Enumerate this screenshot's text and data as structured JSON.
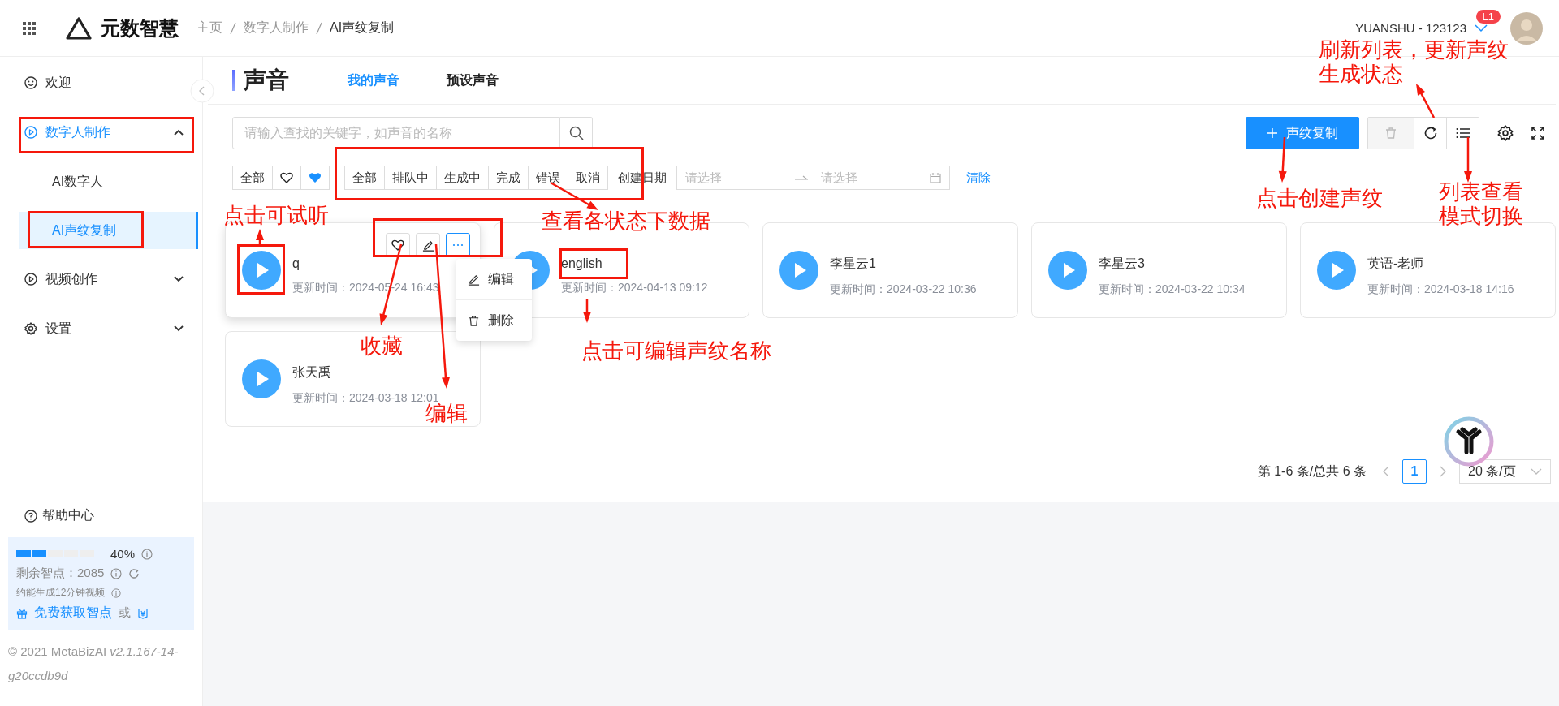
{
  "header": {
    "app_name": "元数智慧",
    "breadcrumbs": [
      "主页",
      "数字人制作",
      "AI声纹复制"
    ],
    "user": "YUANSHU - 123123",
    "level_badge": "L1"
  },
  "sidebar": {
    "items": [
      {
        "label": "欢迎"
      },
      {
        "label": "数字人制作",
        "expanded": true,
        "children": [
          {
            "label": "AI数字人",
            "selected": false
          },
          {
            "label": "AI声纹复制",
            "selected": true
          }
        ]
      },
      {
        "label": "视频创作",
        "expanded": false
      },
      {
        "label": "设置",
        "expanded": false
      }
    ],
    "help": "帮助中心",
    "quota": {
      "level": 0.4,
      "percent": "40%",
      "remaining": "剩余智点：2085",
      "estimate": "约能生成12分钟视频",
      "free_link": "免费获取智点",
      "or": "或"
    },
    "copyright": "© 2021 MetaBizAI *v2.1.167-14-g20ccdb9d*"
  },
  "page": {
    "title": "声音",
    "tabs": [
      {
        "label": "我的声音",
        "selected": true
      },
      {
        "label": "预设声音",
        "selected": false
      }
    ]
  },
  "toolbar": {
    "search_placeholder": "请输入查找的关键字，如声音的名称",
    "create_button": "声纹复制",
    "delete_disabled": true
  },
  "filters": {
    "favorite_all": "全部",
    "statuses": [
      "全部",
      "排队中",
      "生成中",
      "完成",
      "错误",
      "取消"
    ],
    "date_label": "创建日期",
    "date_start_placeholder": "请选择",
    "date_end_placeholder": "请选择",
    "clear": "清除"
  },
  "voices": [
    {
      "name": "q",
      "updated": "更新时间：2024-05-24 16:43",
      "hovered": true
    },
    {
      "name": "english",
      "updated": "更新时间：2024-04-13 09:12",
      "hovered": false
    },
    {
      "name": "李星云1",
      "updated": "更新时间：2024-03-22 10:36",
      "hovered": false
    },
    {
      "name": "李星云3",
      "updated": "更新时间：2024-03-22 10:34",
      "hovered": false
    },
    {
      "name": "英语-老师",
      "updated": "更新时间：2024-03-18 14:16",
      "hovered": false
    },
    {
      "name": "张天禹",
      "updated": "更新时间：2024-03-18 12:01",
      "hovered": false
    }
  ],
  "card_menu": [
    "编辑",
    "删除"
  ],
  "pagination": {
    "summary": "第 1-6 条/总共 6 条",
    "pages": [
      {
        "label": "1",
        "selected": true
      }
    ],
    "page_size": "20 条/页"
  },
  "annotations": [
    {
      "text": "点击可试听"
    },
    {
      "text": "收藏"
    },
    {
      "text": "编辑"
    },
    {
      "text": "查看各状态下数据"
    },
    {
      "text": "点击可编辑声纹名称"
    },
    {
      "text": "点击创建声纹"
    },
    {
      "text": "刷新列表，更新声纹生成状态"
    },
    {
      "text": "列表查看模式切换"
    }
  ]
}
